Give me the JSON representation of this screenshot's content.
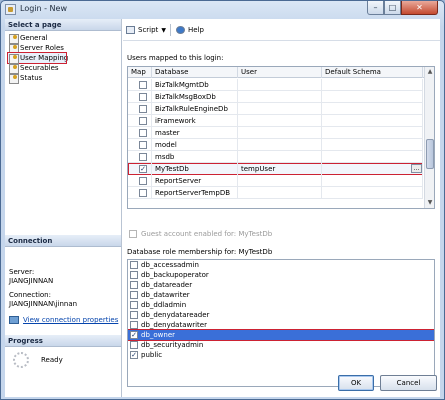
{
  "window": {
    "title": "Login - New"
  },
  "left": {
    "select_page_header": "Select a page",
    "pages": [
      {
        "label": "General"
      },
      {
        "label": "Server Roles"
      },
      {
        "label": "User Mapping"
      },
      {
        "label": "Securables"
      },
      {
        "label": "Status"
      }
    ],
    "connection_header": "Connection",
    "server_label": "Server:",
    "server_value": "JIANGJINNAN",
    "connection_label": "Connection:",
    "connection_value": "JIANGJINNAN\\jinnan",
    "view_props_link": "View connection properties",
    "progress_header": "Progress",
    "progress_status": "Ready"
  },
  "toolbar": {
    "script_label": "Script",
    "help_label": "Help"
  },
  "users_mapped": {
    "label": "Users mapped to this login:",
    "columns": [
      "Map",
      "Database",
      "User",
      "Default Schema"
    ],
    "rows": [
      {
        "checked": false,
        "database": "BizTalkMgmtDb",
        "user": "",
        "schema": ""
      },
      {
        "checked": false,
        "database": "BizTalkMsgBoxDb",
        "user": "",
        "schema": ""
      },
      {
        "checked": false,
        "database": "BizTalkRuleEngineDb",
        "user": "",
        "schema": ""
      },
      {
        "checked": false,
        "database": "iFramework",
        "user": "",
        "schema": ""
      },
      {
        "checked": false,
        "database": "master",
        "user": "",
        "schema": ""
      },
      {
        "checked": false,
        "database": "model",
        "user": "",
        "schema": ""
      },
      {
        "checked": false,
        "database": "msdb",
        "user": "",
        "schema": ""
      },
      {
        "checked": true,
        "database": "MyTestDb",
        "user": "tempUser",
        "schema": ""
      },
      {
        "checked": false,
        "database": "ReportServer",
        "user": "",
        "schema": ""
      },
      {
        "checked": false,
        "database": "ReportServerTempDB",
        "user": "",
        "schema": ""
      }
    ]
  },
  "guest_label": "Guest account enabled for: MyTestDb",
  "roles": {
    "label": "Database role membership for: MyTestDb",
    "items": [
      {
        "name": "db_accessadmin",
        "checked": false
      },
      {
        "name": "db_backupoperator",
        "checked": false
      },
      {
        "name": "db_datareader",
        "checked": false
      },
      {
        "name": "db_datawriter",
        "checked": false
      },
      {
        "name": "db_ddladmin",
        "checked": false
      },
      {
        "name": "db_denydatareader",
        "checked": false
      },
      {
        "name": "db_denydatawriter",
        "checked": false
      },
      {
        "name": "db_owner",
        "checked": true
      },
      {
        "name": "db_securityadmin",
        "checked": false
      },
      {
        "name": "public",
        "checked": true
      }
    ]
  },
  "buttons": {
    "ok": "OK",
    "cancel": "Cancel"
  },
  "check_glyph": "✓"
}
